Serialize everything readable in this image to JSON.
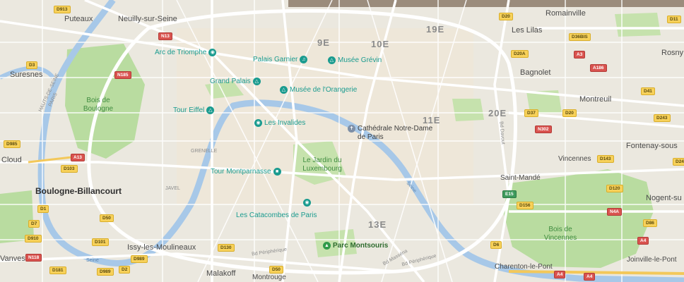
{
  "colors": {
    "background": "#ebe8df",
    "park": "#b9dca0",
    "water": "#a7c8e8",
    "major_road": "#ffffff",
    "poi_teal": "#1a9b8f",
    "poi_green": "#2f9a4a"
  },
  "cities": {
    "puteaux": "Puteaux",
    "neuilly": "Neuilly-sur-Seine",
    "suresnes": "Suresnes",
    "cloud": "Cloud",
    "boulogne": "Boulogne-Billancourt",
    "issy": "Issy-les-Moulineaux",
    "malakoff": "Malakoff",
    "montrouge": "Montrouge",
    "vanves": "Vanves",
    "romainville": "Romainville",
    "les_lilas": "Les Lilas",
    "rosny": "Rosny",
    "bagnolet": "Bagnolet",
    "montreuil": "Montreuil",
    "fontenay": "Fontenay-sous",
    "vincennes": "Vincennes",
    "saint_mande": "Saint-Mandé",
    "nogent": "Nogent-su",
    "charenton": "Charenton-le-Pont",
    "joinville": "Joinville-le-Pont"
  },
  "arrondissements": {
    "a9": "9E",
    "a10": "10E",
    "a19": "19E",
    "a11": "11E",
    "a20": "20E",
    "a13": "13E"
  },
  "pois": {
    "arc": "Arc de Triomphe",
    "garnier": "Palais Garnier",
    "grevin": "Musée Grévin",
    "grand_palais": "Grand Palais",
    "orangerie": "Musée de l'Orangerie",
    "eiffel": "Tour Eiffel",
    "invalides": "Les Invalides",
    "notre_dame": "Cathédrale Notre-Dame de Paris",
    "montparnasse": "Tour Montparnasse",
    "catacombes": "Les Catacombes de Paris",
    "montsouris": "Parc Montsouris",
    "jardin_lux": "Le Jardin du Luxembourg"
  },
  "parks": {
    "boulogne": "Bois de Boulogne",
    "vincennes": "Bois de Vincennes"
  },
  "streets": {
    "grenelle": "GRENELLE",
    "javel": "JAVEL",
    "hauts_seine": "HAUTS-DE-SEINE",
    "paris": "PARIS",
    "bd_peripherique_1": "Bd Périphérique",
    "bd_peripherique_2": "Bd Périphérique",
    "bd_massena": "Bd Masséna",
    "bd_davout": "Bd Davout",
    "seine_1": "Seine",
    "seine_2": "Seine"
  },
  "road_shields": {
    "d913": "D913",
    "n13": "N13",
    "d3": "D3",
    "n185": "N185",
    "d985": "D985",
    "a13": "A13",
    "d103": "D103",
    "d1": "D1",
    "d7": "D7",
    "d50a": "D50",
    "d910": "D910",
    "n118": "N118",
    "d101": "D101",
    "d989a": "D989",
    "d2": "D2",
    "d181": "D181",
    "d989b": "D989",
    "d130": "D130",
    "d50b": "D50",
    "d20": "D20",
    "d20a": "D20A",
    "d36bis": "D36BIS",
    "a3": "A3",
    "a186": "A186",
    "d37": "D37",
    "d20b": "D20",
    "n302": "N302",
    "d41": "D41",
    "d243": "D243",
    "d143": "D143",
    "d24": "D24",
    "e15": "E15",
    "d120": "D120",
    "n4a": "N4A",
    "d156": "D156",
    "d86": "D86",
    "d6": "D6",
    "a4a": "A4",
    "a4b": "A4",
    "a4c": "A4",
    "d11": "D11"
  }
}
